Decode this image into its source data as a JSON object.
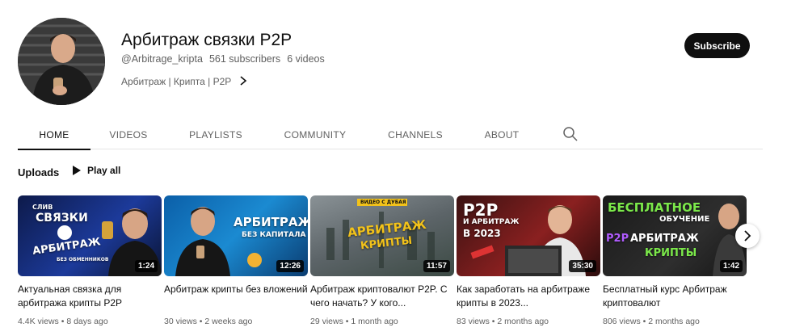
{
  "channel": {
    "title": "Арбитраж связки P2P",
    "handle": "@Arbitrage_kripta",
    "subscribers": "561 subscribers",
    "videos": "6 videos",
    "links": "Арбитраж | Крипта | P2P",
    "subscribe_label": "Subscribe"
  },
  "tabs": [
    {
      "label": "HOME",
      "active": true
    },
    {
      "label": "VIDEOS",
      "active": false
    },
    {
      "label": "PLAYLISTS",
      "active": false
    },
    {
      "label": "COMMUNITY",
      "active": false
    },
    {
      "label": "CHANNELS",
      "active": false
    },
    {
      "label": "ABOUT",
      "active": false
    }
  ],
  "uploads": {
    "label": "Uploads",
    "play_all": "Play all"
  },
  "videos": [
    {
      "title": "Актуальная связка для арбитража крипты P2P",
      "views": "4.4K views",
      "age": "8 days ago",
      "duration": "1:24",
      "thumb_text": [
        "СЛИВ",
        "СВЯЗКИ",
        "АРБИТРАЖ",
        "БЕЗ ОБМЕННИКОВ"
      ]
    },
    {
      "title": "Арбитраж крипты без вложений",
      "views": "30 views",
      "age": "2 weeks ago",
      "duration": "12:26",
      "thumb_text": [
        "АРБИТРАЖ",
        "БЕЗ КАПИТАЛА"
      ]
    },
    {
      "title": "Арбитраж криптовалют P2P. С чего начать? У кого...",
      "views": "29 views",
      "age": "1 month ago",
      "duration": "11:57",
      "thumb_text": [
        "ВИДЕО С ДУБАЯ",
        "АРБИТРАЖ",
        "КРИПТЫ"
      ]
    },
    {
      "title": "Как заработать на арбитраже крипты в 2023...",
      "views": "83 views",
      "age": "2 months ago",
      "duration": "35:30",
      "thumb_text": [
        "P2P",
        "И АРБИТРАЖ",
        "В 2023"
      ]
    },
    {
      "title": "Бесплатный курс Арбитраж криптовалют",
      "views": "806 views",
      "age": "2 months ago",
      "duration": "1:42",
      "thumb_text": [
        "БЕСПЛАТНОЕ",
        "ОБУЧЕНИЕ",
        "P2P",
        "АРБИТРАЖ",
        "КРИПТЫ"
      ]
    }
  ],
  "meta_separator": "•",
  "icons": {
    "search": "search-icon",
    "next": "chevron-right-icon",
    "links_chevron": "chevron-right-icon"
  },
  "colors": {
    "subscribe_bg": "#0f0f0f",
    "text_primary": "#0f0f0f",
    "text_secondary": "#606060"
  }
}
